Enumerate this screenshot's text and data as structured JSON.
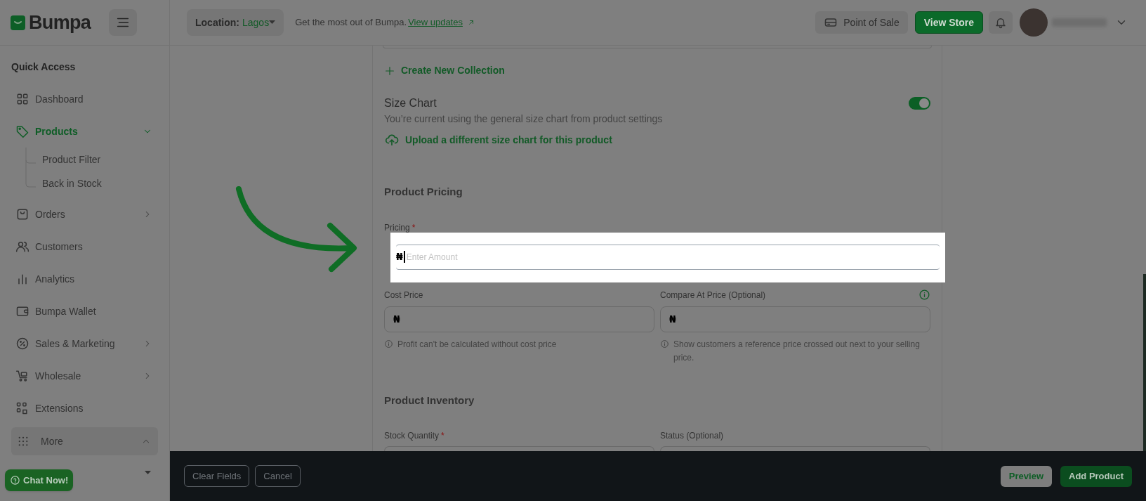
{
  "brand": {
    "name": "Bumpa"
  },
  "topbar": {
    "location_label": "Location:",
    "location_value": "Lagos",
    "promo": "Get the most out of Bumpa.",
    "promo_link": "View updates",
    "buttons": [
      {
        "label": "Point of Sale",
        "kind": "secondary"
      },
      {
        "label": "View Store",
        "kind": "primary"
      }
    ]
  },
  "sidebar": {
    "heading": "Quick Access",
    "items": [
      {
        "label": "Dashboard",
        "selected": false
      },
      {
        "label": "Products",
        "selected": true,
        "expanded": true,
        "children": [
          {
            "label": "Product Filter"
          },
          {
            "label": "Back in Stock"
          }
        ]
      },
      {
        "label": "Orders",
        "selected": false,
        "expanded": false
      },
      {
        "label": "Customers",
        "selected": false
      },
      {
        "label": "Analytics",
        "selected": false
      },
      {
        "label": "Bumpa Wallet",
        "selected": false
      },
      {
        "label": "Sales & Marketing",
        "selected": false,
        "expanded": false
      },
      {
        "label": "Wholesale",
        "selected": false,
        "expanded": false
      },
      {
        "label": "Extensions",
        "selected": false
      }
    ],
    "more": {
      "label": "More",
      "expanded": true
    }
  },
  "form": {
    "create_collection": "Create New Collection",
    "size_chart": {
      "title": "Size Chart",
      "on": true,
      "description": "You’re current using the general size chart from product settings",
      "upload_link": "Upload a different size chart for this product"
    },
    "pricing": {
      "heading": "Product Pricing",
      "price": {
        "label": "Pricing",
        "required_mark": "*",
        "currency": "₦",
        "placeholder": "Enter Amount",
        "focused": true
      },
      "fields": [
        {
          "label": "Cost Price",
          "currency": "₦",
          "hint": "Profit can't be calculated without cost price"
        },
        {
          "label": "Compare At Price (Optional)",
          "currency": "₦",
          "hint": "Show customers a reference price crossed out next to your selling price."
        }
      ]
    },
    "inventory": {
      "heading": "Product Inventory",
      "fields": [
        {
          "label": "Stock Quantity",
          "required_mark": "*"
        },
        {
          "label": "Status (Optional)"
        }
      ]
    }
  },
  "footer": {
    "left_buttons": [
      "Clear Fields",
      "Cancel"
    ],
    "right_buttons": [
      {
        "label": "Preview",
        "kind": "secondary"
      },
      {
        "label": "Add Product",
        "kind": "primary"
      }
    ]
  },
  "chat": {
    "label": "Chat Now!"
  }
}
